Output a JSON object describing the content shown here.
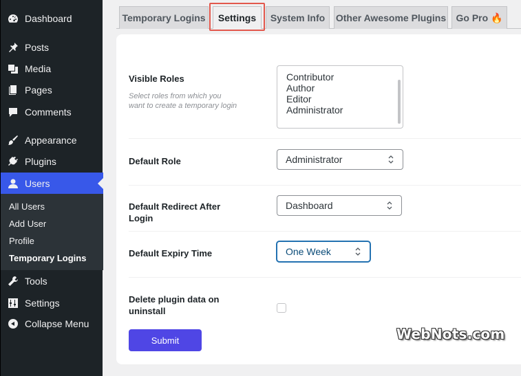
{
  "sidebar": {
    "items": [
      {
        "label": "Dashboard",
        "icon": "dashboard-icon"
      },
      {
        "label": "Posts",
        "icon": "pin-icon"
      },
      {
        "label": "Media",
        "icon": "media-icon"
      },
      {
        "label": "Pages",
        "icon": "pages-icon"
      },
      {
        "label": "Comments",
        "icon": "comment-icon"
      },
      {
        "label": "Appearance",
        "icon": "brush-icon"
      },
      {
        "label": "Plugins",
        "icon": "plug-icon"
      },
      {
        "label": "Users",
        "icon": "user-icon"
      },
      {
        "label": "Tools",
        "icon": "wrench-icon"
      },
      {
        "label": "Settings",
        "icon": "sliders-icon"
      },
      {
        "label": "Collapse Menu",
        "icon": "collapse-icon"
      }
    ],
    "users_submenu": [
      "All Users",
      "Add User",
      "Profile",
      "Temporary Logins"
    ],
    "active_color": "#3858e9"
  },
  "tabs": [
    "Temporary Logins",
    "Settings",
    "System Info",
    "Other Awesome Plugins",
    "Go Pro 🔥"
  ],
  "form": {
    "visible_roles": {
      "label": "Visible Roles",
      "description": "Select roles from which you want to create a temporary login",
      "options": [
        "Contributor",
        "Author",
        "Editor",
        "Administrator"
      ]
    },
    "default_role": {
      "label": "Default Role",
      "value": "Administrator"
    },
    "default_redirect": {
      "label": "Default Redirect After Login",
      "value": "Dashboard"
    },
    "default_expiry": {
      "label": "Default Expiry Time",
      "value": "One Week"
    },
    "delete_data": {
      "label": "Delete plugin data on uninstall",
      "checked": false
    },
    "submit_label": "Submit"
  },
  "watermark": "WebNots.com",
  "colors": {
    "submit": "#4f46e5",
    "highlight": "#e2574c"
  }
}
